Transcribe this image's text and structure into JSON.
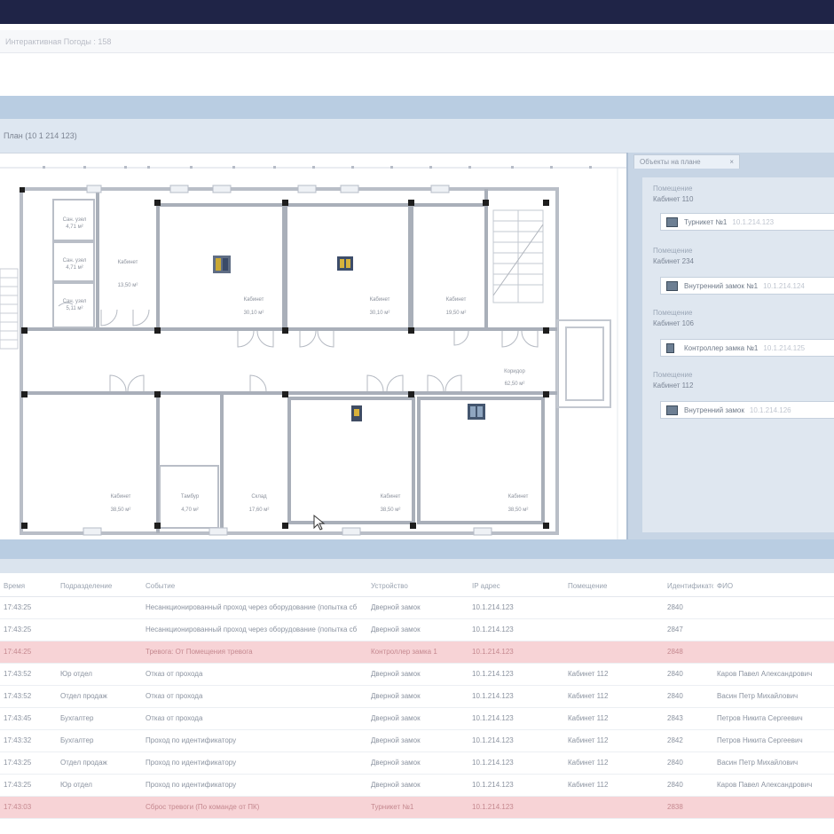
{
  "app": {
    "breadcrumb": "Интерактивная Погоды : 158"
  },
  "plan": {
    "title": "План (10 1 214 123)",
    "rooms": [
      {
        "name": "Сан. узел",
        "area": "4,71 м²"
      },
      {
        "name": "Сан. узел",
        "area": "4,71 м²"
      },
      {
        "name": "Сан. узел",
        "area": "5,11 м²"
      },
      {
        "name": "Кабинет",
        "area": "13,50 м²"
      },
      {
        "name": "Кабинет",
        "area": "30,10 м²"
      },
      {
        "name": "Кабинет",
        "area": "30,10 м²"
      },
      {
        "name": "Кабинет",
        "area": "19,50 м²"
      },
      {
        "name": "Коридор",
        "area": "62,50 м²"
      },
      {
        "name": "Кабинет",
        "area": "38,50 м²"
      },
      {
        "name": "Тамбур",
        "area": "4,70 м²"
      },
      {
        "name": "Склад",
        "area": "17,60 м²"
      },
      {
        "name": "Кабинет",
        "area": "38,50 м²"
      },
      {
        "name": "Кабинет",
        "area": "38,50 м²"
      }
    ]
  },
  "side_panel": {
    "tab_label": "Объекты на плане",
    "tab_close": "×",
    "groups": [
      {
        "type": "Помещение",
        "room": "Кабинет 110",
        "device": "Турникет №1",
        "ip": "10.1.214.123"
      },
      {
        "type": "Помещение",
        "room": "Кабинет 234",
        "device": "Внутренний замок №1",
        "ip": "10.1.214.124"
      },
      {
        "type": "Помещение",
        "room": "Кабинет 106",
        "device": "Контроллер замка №1",
        "ip": "10.1.214.125"
      },
      {
        "type": "Помещение",
        "room": "Кабинет 112",
        "device": "Внутренний замок",
        "ip": "10.1.214.126"
      }
    ]
  },
  "log": {
    "columns": [
      "Время",
      "Подразделение",
      "Событие",
      "Устройство",
      "IP адрес",
      "Помещение",
      "Идентификатор",
      "ФИО"
    ],
    "rows": [
      {
        "time": "17:43:25",
        "dept": "",
        "event": "Несанкционированный проход через оборудование (попытка сб",
        "device": "Дверной замок",
        "ip": "10.1.214.123",
        "room": "",
        "id": "2840",
        "name": "",
        "alarm": false
      },
      {
        "time": "17:43:25",
        "dept": "",
        "event": "Несанкционированный проход через оборудование (попытка сб",
        "device": "Дверной замок",
        "ip": "10.1.214.123",
        "room": "",
        "id": "2847",
        "name": "",
        "alarm": false
      },
      {
        "time": "17:44:25",
        "dept": "",
        "event": "Тревога: От Помещения тревога",
        "device": "Контроллер замка 1",
        "ip": "10.1.214.123",
        "room": "",
        "id": "2848",
        "name": "",
        "alarm": true
      },
      {
        "time": "17:43:52",
        "dept": "Юр отдел",
        "event": "Отказ от прохода",
        "device": "Дверной замок",
        "ip": "10.1.214.123",
        "room": "Кабинет 112",
        "id": "2840",
        "name": "Каров Павел Александрович",
        "alarm": false
      },
      {
        "time": "17:43:52",
        "dept": "Отдел продаж",
        "event": "Отказ от прохода",
        "device": "Дверной замок",
        "ip": "10.1.214.123",
        "room": "Кабинет 112",
        "id": "2840",
        "name": "Васин Петр Михайлович",
        "alarm": false
      },
      {
        "time": "17:43:45",
        "dept": "Бухгалтер",
        "event": "Отказ от прохода",
        "device": "Дверной замок",
        "ip": "10.1.214.123",
        "room": "Кабинет 112",
        "id": "2843",
        "name": "Петров Никита Сергеевич",
        "alarm": false
      },
      {
        "time": "17:43:32",
        "dept": "Бухгалтер",
        "event": "Проход по идентификатору",
        "device": "Дверной замок",
        "ip": "10.1.214.123",
        "room": "Кабинет 112",
        "id": "2842",
        "name": "Петров Никита Сергеевич",
        "alarm": false
      },
      {
        "time": "17:43:25",
        "dept": "Отдел продаж",
        "event": "Проход по идентификатору",
        "device": "Дверной замок",
        "ip": "10.1.214.123",
        "room": "Кабинет 112",
        "id": "2840",
        "name": "Васин Петр Михайлович",
        "alarm": false
      },
      {
        "time": "17:43:25",
        "dept": "Юр отдел",
        "event": "Проход по идентификатору",
        "device": "Дверной замок",
        "ip": "10.1.214.123",
        "room": "Кабинет 112",
        "id": "2840",
        "name": "Каров Павел Александрович",
        "alarm": false
      },
      {
        "time": "17:43:03",
        "dept": "",
        "event": "Сброс тревоги (По команде от ПК)",
        "device": "Турникет №1",
        "ip": "10.1.214.123",
        "room": "",
        "id": "2838",
        "name": "",
        "alarm": true
      }
    ]
  },
  "colors": {
    "topbar": "#1f2447",
    "band": "#b9cde2",
    "alarm_row": "#f7d3d6",
    "side_panel": "#c7d5e5"
  }
}
